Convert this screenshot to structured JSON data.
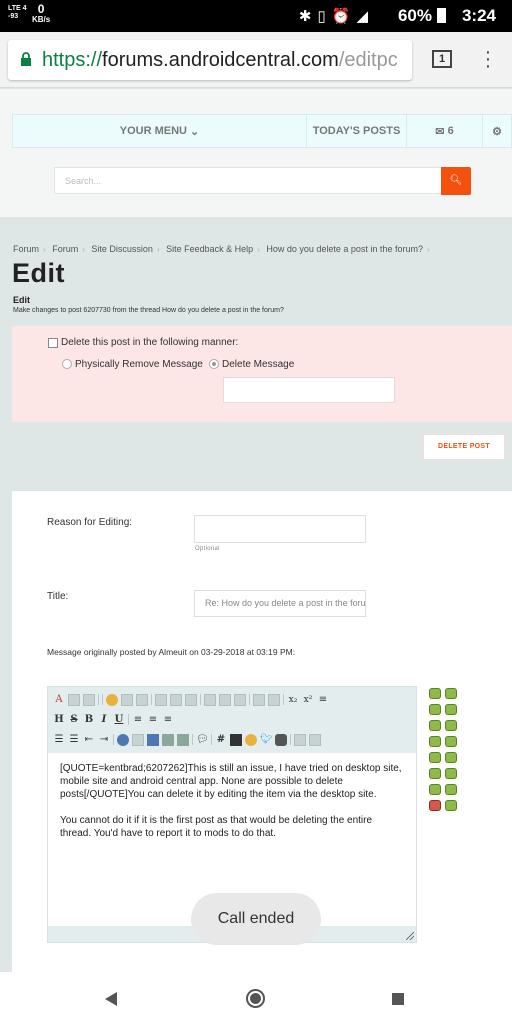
{
  "status_bar": {
    "network_top": "LTE 4",
    "network_bottom": "-93",
    "data_rate": "0",
    "data_unit": "KB/s",
    "battery": "60%",
    "time": "3:24"
  },
  "browser": {
    "url_scheme": "https://",
    "url_host": "forums.androidcentral.com",
    "url_path": "/editpc",
    "tab_count": "1"
  },
  "site_nav": {
    "menu_label": "YOUR MENU",
    "today_label": "TODAY'S POSTS",
    "mail_count": "6",
    "search_placeholder": "Search..."
  },
  "breadcrumbs": [
    "Forum",
    "Forum",
    "Site Discussion",
    "Site Feedback & Help",
    "How do you delete a post in the forum?"
  ],
  "page": {
    "title": "Edit",
    "subtitle": "Edit",
    "description": "Make changes to post 6207730 from the thread How do you delete a post in the forum?"
  },
  "delete_panel": {
    "checkbox_label": "Delete this post in the following manner:",
    "option_physical": "Physically Remove Message",
    "option_delete": "Delete Message",
    "selected": "Delete Message",
    "button_label": "DELETE POST"
  },
  "form": {
    "reason_label": "Reason for Editing:",
    "reason_hint": "Optional",
    "title_label": "Title:",
    "title_value": "Re: How do you delete a post in the forum?",
    "original_posted": "Message originally posted by Almeuit on 03-29-2018 at 03:19 PM:",
    "message": "[QUOTE=kentbrad;6207262]This is still an issue, I have tried on desktop site, mobile site and android central app. None are possible to delete posts[/QUOTE]You can delete it by editing the item via the desktop site.\n\nYou cannot do it if it is the first post as that would be deleting the entire thread. You'd have to report it to mods to do that."
  },
  "toast": "Call ended",
  "colors": {
    "accent": "#f4500e",
    "nav_bg": "#ecfcfc",
    "delete_panel_bg": "#fde6e6",
    "page_bg": "#dfe6e6"
  }
}
